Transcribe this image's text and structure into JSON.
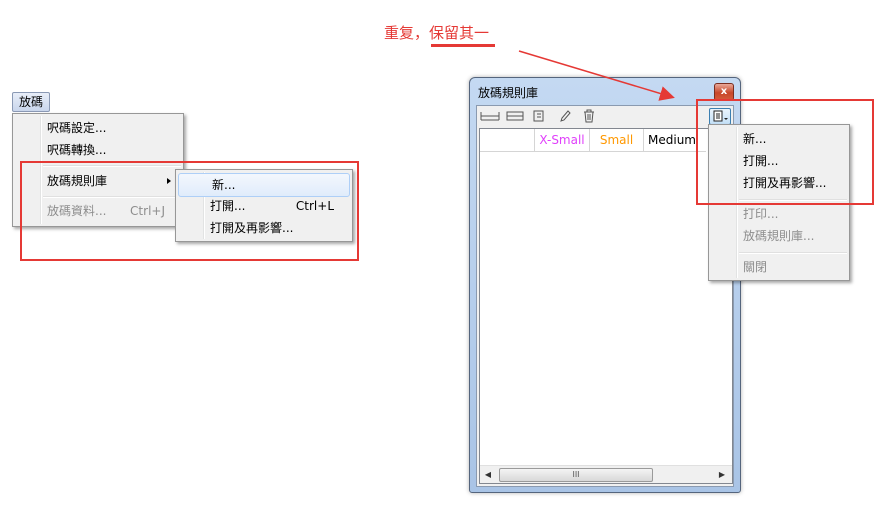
{
  "annotation": {
    "prefix": "重复，",
    "highlight": "保留其一"
  },
  "menubar": {
    "label": "放碼"
  },
  "left_menu": {
    "items": [
      {
        "label": "呎碼設定...",
        "shortcut": "",
        "disabled": false
      },
      {
        "label": "呎碼轉換...",
        "shortcut": "",
        "disabled": false
      },
      {
        "label": "放碼規則庫",
        "shortcut": "",
        "disabled": false,
        "submenu": true
      },
      {
        "label": "放碼資料...",
        "shortcut": "Ctrl+J",
        "disabled": true
      }
    ]
  },
  "left_submenu": {
    "items": [
      {
        "label": "新...",
        "shortcut": ""
      },
      {
        "label": "打開...",
        "shortcut": "Ctrl+L"
      },
      {
        "label": "打開及再影響...",
        "shortcut": ""
      }
    ]
  },
  "window": {
    "title": "放碼規則庫",
    "close_label": "x",
    "columns": [
      {
        "label": "",
        "color": "#000000"
      },
      {
        "label": "X-Small",
        "color": "#e040fb"
      },
      {
        "label": "Small",
        "color": "#ff9800"
      },
      {
        "label": "Medium",
        "color": "#000000"
      }
    ],
    "scroll_thumb": "III"
  },
  "dropdown": {
    "items": [
      {
        "label": "新...",
        "disabled": false
      },
      {
        "label": "打開...",
        "disabled": false
      },
      {
        "label": "打開及再影響...",
        "disabled": false
      },
      {
        "label": "打印...",
        "disabled": true
      },
      {
        "label": "放碼規則庫...",
        "disabled": true
      },
      {
        "label": "關閉",
        "disabled": true
      }
    ]
  },
  "colors": {
    "highlight_red": "#e53935"
  }
}
